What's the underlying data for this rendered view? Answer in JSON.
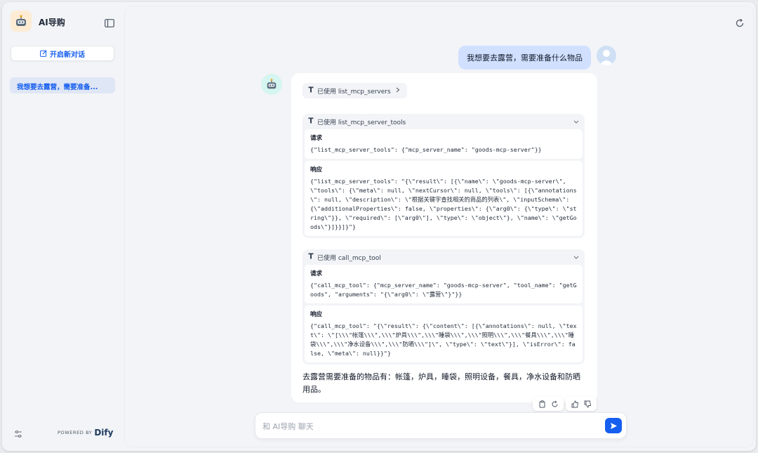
{
  "app": {
    "name": "AI导购"
  },
  "sidebar": {
    "new_chat_label": "开启新对话",
    "conversations": [
      {
        "label": "我想要去露营，需要准备..."
      }
    ],
    "powered_by": "POWERED BY",
    "brand": "Dify"
  },
  "chat": {
    "user_message": "我想要去露营，需要准备什么物品",
    "tools": [
      {
        "label": "已使用 list_mcp_servers",
        "expanded": false
      },
      {
        "label": "已使用 list_mcp_server_tools",
        "expanded": true,
        "request_label": "请求",
        "request": "{\"list_mcp_server_tools\": {\"mcp_server_name\": \"goods-mcp-server\"}}",
        "response_label": "响应",
        "response": "{\"list_mcp_server_tools\": \"{\\\"result\\\": [{\\\"name\\\": \\\"goods-mcp-server\\\", \\\"tools\\\": {\\\"meta\\\": null, \\\"nextCursor\\\": null, \\\"tools\\\": [{\\\"annotations\\\": null, \\\"description\\\": \\\"根据关键字查找相关的商品的列表\\\", \\\"inputSchema\\\": {\\\"additionalProperties\\\": false, \\\"properties\\\": {\\\"arg0\\\": {\\\"type\\\": \\\"string\\\"}}, \\\"required\\\": [\\\"arg0\\\"], \\\"type\\\": \\\"object\\\"}, \\\"name\\\": \\\"getGoods\\\"}]}}]}\"}"
      },
      {
        "label": "已使用 call_mcp_tool",
        "expanded": true,
        "request_label": "请求",
        "request": "{\"call_mcp_tool\": {\"mcp_server_name\": \"goods-mcp-server\", \"tool_name\": \"getGoods\", \"arguments\": \"{\\\"arg0\\\": \\\"露营\\\"}\"}}",
        "response_label": "响应",
        "response": "{\"call_mcp_tool\": \"{\\\"result\\\": {\\\"content\\\": [{\\\"annotations\\\": null, \\\"text\\\": \\\"[\\\\\\\"帐篷\\\\\\\",\\\\\\\"炉具\\\\\\\",\\\\\\\"睡袋\\\\\\\",\\\\\\\"照明\\\\\\\",\\\\\\\"餐具\\\\\\\",\\\\\\\"睡袋\\\\\\\",\\\\\\\"净水设备\\\\\\\",\\\\\\\"防晒\\\\\\\"]\\\", \\\"type\\\": \\\"text\\\"}], \\\"isError\\\": false, \\\"meta\\\": null}}\"}"
      }
    ],
    "answer": "去露营需要准备的物品有：帐篷，炉具，睡袋，照明设备，餐具，净水设备和防晒用品。"
  },
  "input": {
    "placeholder": "和 AI导购 聊天",
    "value": ""
  },
  "colors": {
    "accent": "#155eef",
    "user_bubble": "#d1e0ff",
    "sidebar_active": "#dfe6f5"
  }
}
